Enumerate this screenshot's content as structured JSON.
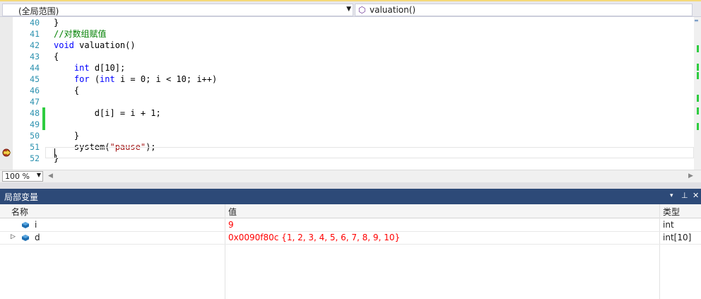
{
  "toolbar": {
    "scope_combo": "(全局范围)",
    "function_combo": "valuation()"
  },
  "editor": {
    "lines": [
      {
        "no": "40",
        "parts": [
          {
            "t": "}",
            "c": ""
          }
        ]
      },
      {
        "no": "41",
        "parts": [
          {
            "t": "//对数组赋值",
            "c": "cm"
          }
        ]
      },
      {
        "no": "42",
        "parts": [
          {
            "t": "void",
            "c": "kw"
          },
          {
            "t": " valuation()",
            "c": ""
          }
        ]
      },
      {
        "no": "43",
        "parts": [
          {
            "t": "{",
            "c": ""
          }
        ]
      },
      {
        "no": "44",
        "parts": [
          {
            "t": "    ",
            "c": ""
          },
          {
            "t": "int",
            "c": "kw"
          },
          {
            "t": " d[10];",
            "c": ""
          }
        ]
      },
      {
        "no": "45",
        "parts": [
          {
            "t": "    ",
            "c": ""
          },
          {
            "t": "for",
            "c": "kw"
          },
          {
            "t": " (",
            "c": ""
          },
          {
            "t": "int",
            "c": "kw"
          },
          {
            "t": " i = 0; i < 10; i++)",
            "c": ""
          }
        ]
      },
      {
        "no": "46",
        "parts": [
          {
            "t": "    {",
            "c": ""
          }
        ]
      },
      {
        "no": "47",
        "parts": [
          {
            "t": "",
            "c": ""
          }
        ]
      },
      {
        "no": "48",
        "parts": [
          {
            "t": "        d[i] = i + 1;",
            "c": ""
          }
        ]
      },
      {
        "no": "49",
        "parts": [
          {
            "t": "",
            "c": ""
          }
        ]
      },
      {
        "no": "50",
        "parts": [
          {
            "t": "    }",
            "c": ""
          }
        ]
      },
      {
        "no": "51",
        "parts": [
          {
            "t": "    system(",
            "c": ""
          },
          {
            "t": "\"pause\"",
            "c": "str"
          },
          {
            "t": ");",
            "c": ""
          }
        ]
      },
      {
        "no": "52",
        "parts": [
          {
            "t": "}",
            "c": ""
          }
        ]
      }
    ]
  },
  "status": {
    "zoom": "100 %"
  },
  "locals_panel": {
    "title": "局部变量",
    "columns": {
      "name": "名称",
      "value": "值",
      "type": "类型"
    },
    "rows": [
      {
        "name": "i",
        "value": "9",
        "type": "int"
      },
      {
        "name": "d",
        "value": "0x0090f80c {1, 2, 3, 4, 5, 6, 7, 8, 9, 10}",
        "type": "int[10]"
      }
    ]
  },
  "colors": {
    "keyword": "#0000ff",
    "comment": "#008000",
    "string": "#a31515",
    "line_number": "#2b91af",
    "changed_value": "#ff0000",
    "panel_title_bg": "#2d4a78",
    "change_bar": "#2ecc40"
  }
}
